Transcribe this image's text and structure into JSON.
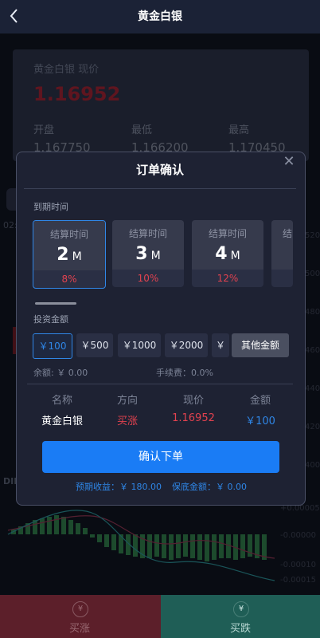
{
  "header": {
    "title": "黄金白银",
    "back_icon": "chevron-left-icon"
  },
  "background_card": {
    "name_label": "黄金白银 现价",
    "price": "1.16952",
    "open_label": "开盘",
    "open_value": "1.167750",
    "low_label": "最低",
    "low_value": "1.166200",
    "high_label": "最高",
    "high_value": "1.170450"
  },
  "background_misc": {
    "time_prefix": "02:",
    "dif_label": "DIF",
    "axis_values": [
      "520",
      "500",
      "480",
      "460",
      "440",
      "420",
      "400"
    ],
    "macd_ticks": [
      "+0.00005",
      "-0.00000",
      "-0.00010",
      "-0.00015"
    ]
  },
  "modal": {
    "title": "订单确认",
    "close_icon": "close-icon",
    "expiry_label": "到期时间",
    "expiry_options": [
      {
        "label": "结算时间",
        "value": "2",
        "unit": "M",
        "rate": "8%",
        "selected": true
      },
      {
        "label": "结算时间",
        "value": "3",
        "unit": "M",
        "rate": "10%",
        "selected": false
      },
      {
        "label": "结算时间",
        "value": "4",
        "unit": "M",
        "rate": "12%",
        "selected": false
      },
      {
        "label": "结",
        "value": "",
        "unit": "",
        "rate": "",
        "selected": false
      }
    ],
    "amount_label": "投资金额",
    "amount_options": [
      {
        "label": "￥100",
        "selected": true
      },
      {
        "label": "￥500",
        "selected": false
      },
      {
        "label": "￥1000",
        "selected": false
      },
      {
        "label": "￥2000",
        "selected": false
      },
      {
        "label": "￥",
        "selected": false
      }
    ],
    "other_amount": "其他金额",
    "balance": "余额: ￥ 0.00",
    "fee": "手续费：0.0%",
    "table_headers": [
      "名称",
      "方向",
      "现价",
      "金额"
    ],
    "table_row": {
      "name": "黄金白银",
      "direction": "买涨",
      "price": "1.16952",
      "amount": "￥100"
    },
    "confirm_button": "确认下单",
    "expected_income": "预期收益：￥ 180.00",
    "margin": "保底金额：￥ 0.00"
  },
  "bottom_bar": {
    "buy_up": {
      "label": "买涨",
      "icon": "yuan-circle-icon"
    },
    "buy_down": {
      "label": "买跌",
      "icon": "yuan-circle-icon"
    }
  },
  "colors": {
    "accent": "#1a7cf5",
    "up": "#e2424f",
    "down": "#1f5e56"
  }
}
